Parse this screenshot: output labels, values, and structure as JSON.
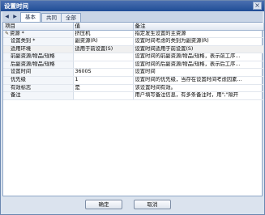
{
  "window": {
    "title": "设置时间",
    "close_glyph": "×"
  },
  "tabs": [
    {
      "label": "基本",
      "active": true
    },
    {
      "label": "共同",
      "active": false
    },
    {
      "label": "全部",
      "active": false
    }
  ],
  "tab_scroll": {
    "left": "◀",
    "right": "▶"
  },
  "grid": {
    "columns": [
      "项目",
      "值",
      "备注"
    ],
    "rows": [
      {
        "item": "资源 *",
        "value": "挤压机",
        "note": "指定发生设置的主资源",
        "pinned": true
      },
      {
        "item": "设置类别 *",
        "value": "副资源(R)",
        "note": "设置时间考虑的类别为副资源(R)"
      },
      {
        "item": "适用环境",
        "value": "适用于前设置(S)",
        "note": "设置时间适用于前设置(S)"
      },
      {
        "item": "前副资源/物品/规格",
        "value": "",
        "note": "设置时间的前副资源/物品/规格，表示前工序..."
      },
      {
        "item": "后副资源/物品/规格",
        "value": "",
        "note": "设置时间的后副资源/物品/规格，表示后工序..."
      },
      {
        "item": "设置时间",
        "value": "3600S",
        "note": "设置时间"
      },
      {
        "item": "优先级",
        "value": "1",
        "note": "设置时间的优先级，当存在设置时间考虑因素..."
      },
      {
        "item": "有效标志",
        "value": "是",
        "note": "该设置时间有效。"
      },
      {
        "item": "备注",
        "value": "",
        "note": "用户填写备注信息，有多条备注时，用\";\"隔开"
      }
    ]
  },
  "footer": {
    "ok_label": "确定",
    "cancel_label": "取消"
  },
  "colors": {
    "titlebar": "#1f4d96",
    "panel": "#dbe3ee",
    "border": "#8ea6c6"
  }
}
